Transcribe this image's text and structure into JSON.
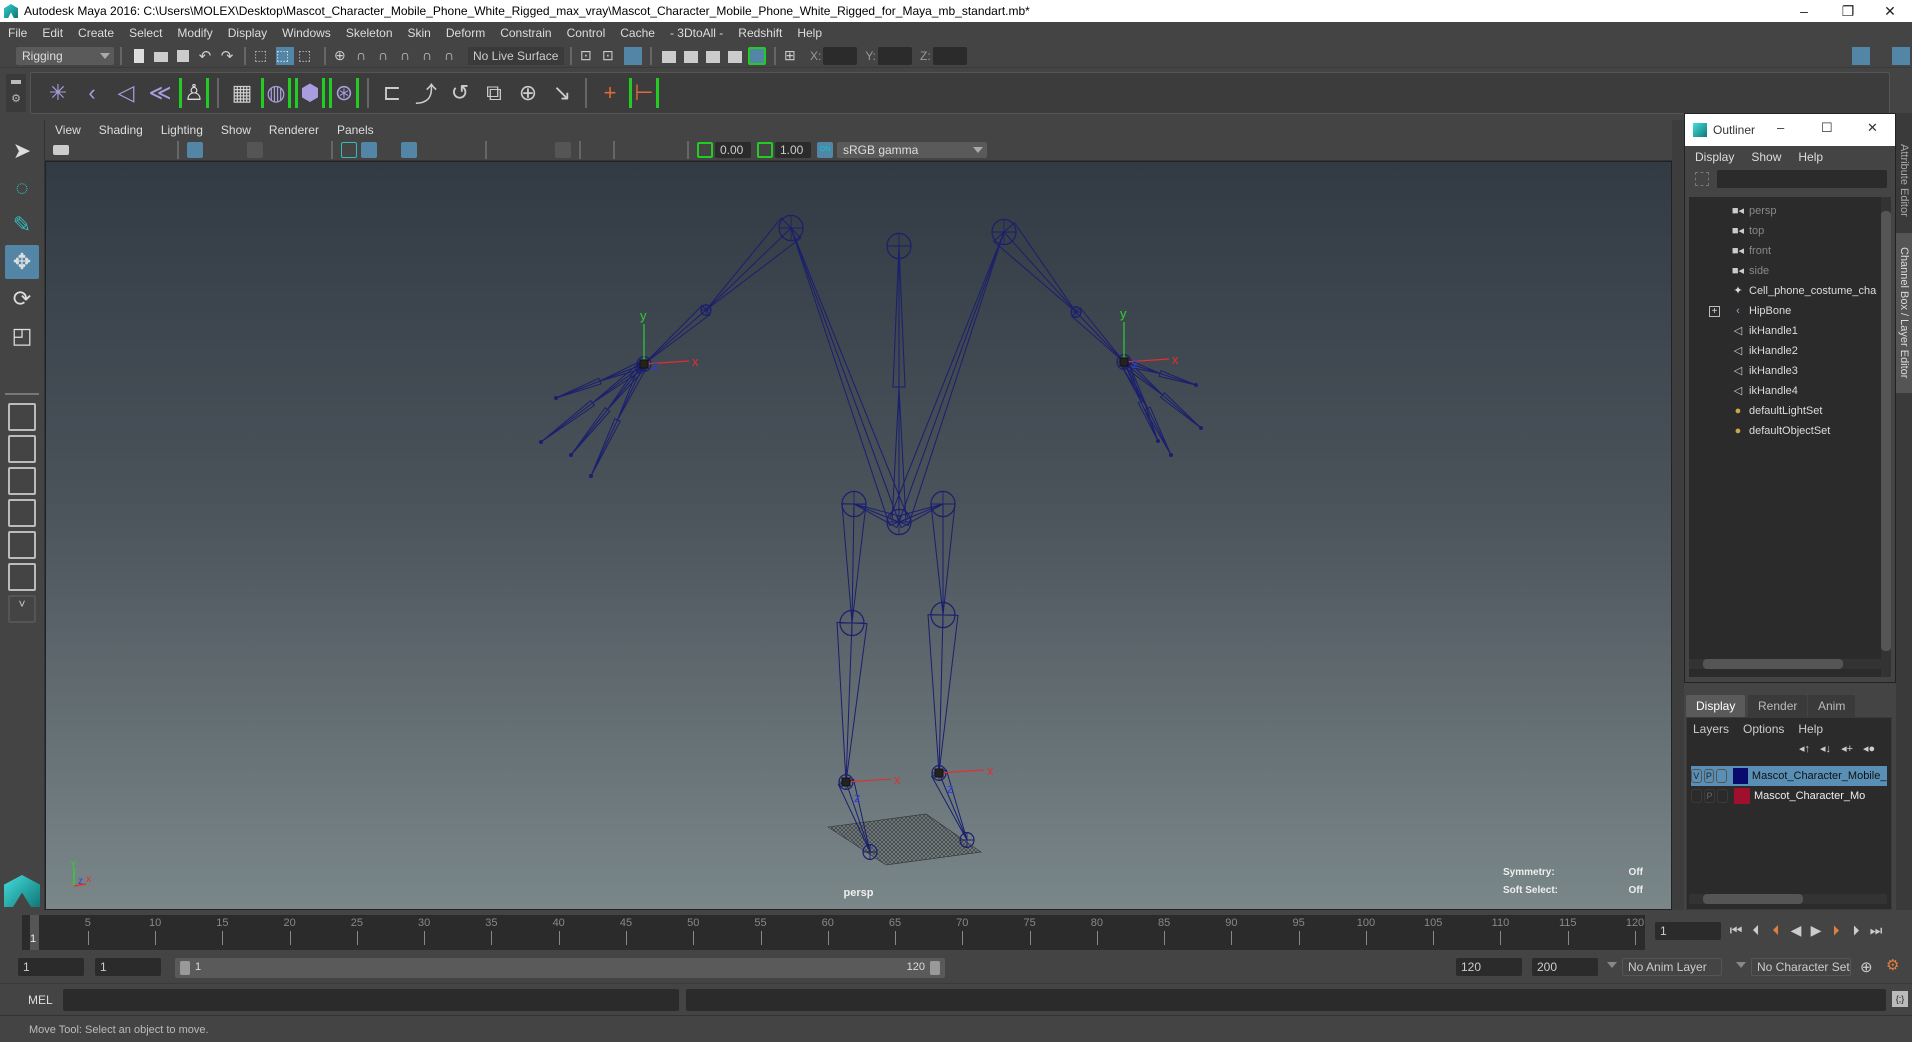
{
  "window": {
    "title": "Autodesk Maya 2016: C:\\Users\\MOLEX\\Desktop\\Mascot_Character_Mobile_Phone_White_Rigged_max_vray\\Mascot_Character_Mobile_Phone_White_Rigged_for_Maya_mb_standart.mb*",
    "minimize": "–",
    "restore": "❐",
    "close": "✕"
  },
  "menubar": [
    "File",
    "Edit",
    "Create",
    "Select",
    "Modify",
    "Display",
    "Windows",
    "Skeleton",
    "Skin",
    "Deform",
    "Constrain",
    "Control",
    "Cache",
    "- 3DtoAll -",
    "Redshift",
    "Help"
  ],
  "statusline": {
    "menuset": "Rigging",
    "live_surface": "No Live Surface",
    "x_label": "X:",
    "y_label": "Y:",
    "z_label": "Z:",
    "x_value": "",
    "y_value": "",
    "z_value": ""
  },
  "shelf": {
    "tools": [
      "joint-tool",
      "ik-handle-tool",
      "ik-spline-tool",
      "insert-joint",
      "humanik-character",
      "paint-skin-weights",
      "bind-skin",
      "create-lattice",
      "create-cluster",
      "parent-constraint",
      "point-constraint",
      "orient-constraint",
      "scale-constraint",
      "aim-constraint",
      "pole-vector-constraint",
      "create-locator",
      "add-influence"
    ]
  },
  "viewport": {
    "menu": [
      "View",
      "Shading",
      "Lighting",
      "Show",
      "Renderer",
      "Panels"
    ],
    "exposure": "0.00",
    "gamma": "1.00",
    "color_mgmt": "ON",
    "view_transform": "sRGB gamma",
    "camera": "persp",
    "hud": [
      {
        "label": "Symmetry:",
        "value": "Off"
      },
      {
        "label": "Soft Select:",
        "value": "Off"
      }
    ],
    "axis_labels": {
      "x": "x",
      "y": "y",
      "z": "z"
    }
  },
  "outliner": {
    "title": "Outliner",
    "menu": [
      "Display",
      "Show",
      "Help"
    ],
    "search": "",
    "items": [
      {
        "label": "persp",
        "icon": "camera-icon",
        "dim": true
      },
      {
        "label": "top",
        "icon": "camera-icon",
        "dim": true
      },
      {
        "label": "front",
        "icon": "camera-icon",
        "dim": true
      },
      {
        "label": "side",
        "icon": "camera-icon",
        "dim": true
      },
      {
        "label": "Cell_phone_costume_cha",
        "icon": "mesh-icon",
        "dim": false
      },
      {
        "label": "HipBone",
        "icon": "joint-icon",
        "dim": false,
        "expandable": true
      },
      {
        "label": "ikHandle1",
        "icon": "ik-handle-icon",
        "dim": false
      },
      {
        "label": "ikHandle2",
        "icon": "ik-handle-icon",
        "dim": false
      },
      {
        "label": "ikHandle3",
        "icon": "ik-handle-icon",
        "dim": false
      },
      {
        "label": "ikHandle4",
        "icon": "ik-handle-icon",
        "dim": false
      },
      {
        "label": "defaultLightSet",
        "icon": "set-icon",
        "dim": false
      },
      {
        "label": "defaultObjectSet",
        "icon": "set-icon",
        "dim": false
      }
    ]
  },
  "side_tabs": [
    "Attribute Editor",
    "Channel Box / Layer Editor"
  ],
  "layer_editor": {
    "tabs": [
      "Display",
      "Render",
      "Anim"
    ],
    "active_tab": "Display",
    "menu": [
      "Layers",
      "Options",
      "Help"
    ],
    "layers": [
      {
        "v": "V",
        "p": "P",
        "color": "#0a0a6e",
        "name": "Mascot_Character_Mobile_P",
        "selected": true
      },
      {
        "v": "",
        "p": "P",
        "color": "#a0102c",
        "name": "Mascot_Character_Mo",
        "selected": false
      }
    ]
  },
  "timeline": {
    "start": 1,
    "end": 120,
    "ticks": [
      5,
      10,
      15,
      20,
      25,
      30,
      35,
      40,
      45,
      50,
      55,
      60,
      65,
      70,
      75,
      80,
      85,
      90,
      95,
      100,
      105,
      110,
      115,
      120
    ],
    "current_frame_label": "1",
    "current_frame_field": "1"
  },
  "range": {
    "start_field": "1",
    "playback_start": "1",
    "range_start": "1",
    "range_end": "120",
    "playback_end": "120",
    "anim_end": "200",
    "anim_layer": "No Anim Layer",
    "character_set": "No Character Set"
  },
  "command_line": {
    "label": "MEL",
    "input": "",
    "output": ""
  },
  "help_line": "Move Tool: Select an object to move.",
  "colors": {
    "accent": "#5285a6",
    "joint": "#1a1f6e",
    "axis_x": "#e03030",
    "axis_y": "#30d030",
    "axis_z": "#2b3fe0",
    "shelf_bracket": "#22cc22",
    "constraint_orange": "#e06a3a"
  }
}
